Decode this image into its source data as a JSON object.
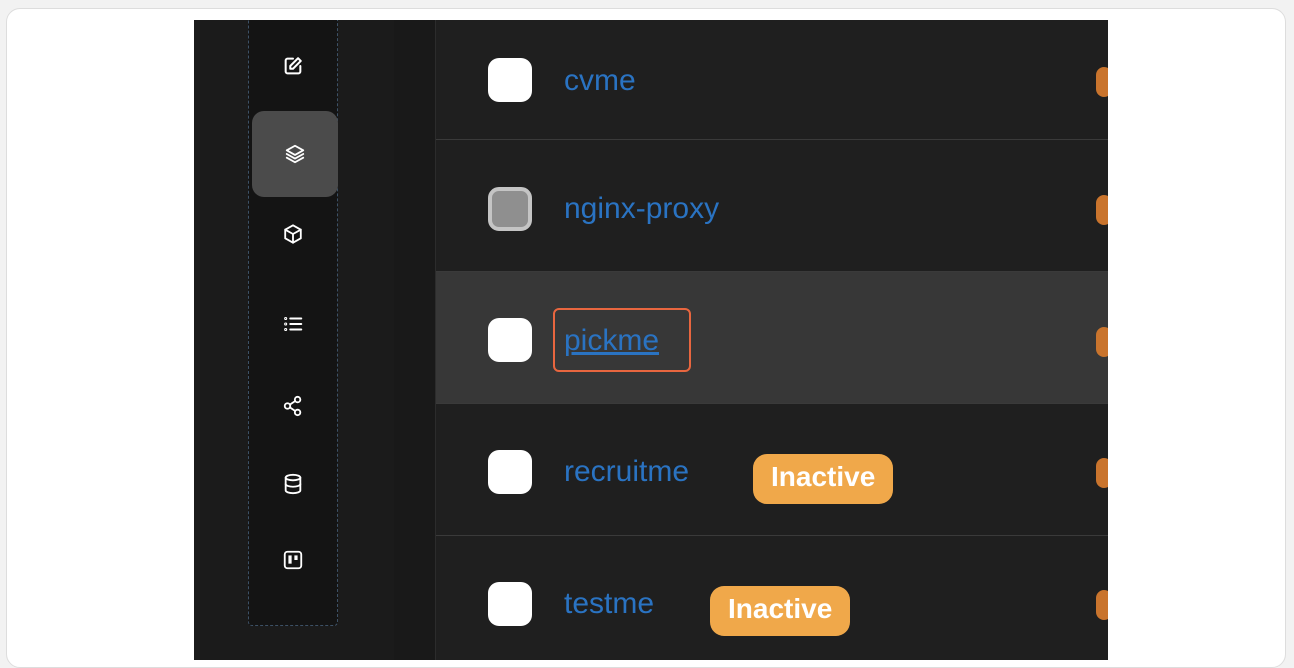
{
  "sidebar": {
    "icons": [
      {
        "name": "edit-icon"
      },
      {
        "name": "stacks-icon",
        "active": true
      },
      {
        "name": "containers-icon"
      },
      {
        "name": "list-icon"
      },
      {
        "name": "network-icon"
      },
      {
        "name": "database-icon"
      },
      {
        "name": "board-icon"
      }
    ]
  },
  "stacks": [
    {
      "name": "cvme",
      "checkbox": "enabled"
    },
    {
      "name": "nginx-proxy",
      "checkbox": "disabled"
    },
    {
      "name": "pickme",
      "checkbox": "enabled",
      "hovered": true,
      "highlighted": true
    },
    {
      "name": "recruitme",
      "checkbox": "enabled",
      "badge": "Inactive"
    },
    {
      "name": "testme",
      "checkbox": "enabled",
      "badge": "Inactive"
    }
  ],
  "colors": {
    "link": "#2a73c2",
    "badge": "#f0a84a",
    "highlight": "#e8663f",
    "background": "#1f1f1f"
  }
}
